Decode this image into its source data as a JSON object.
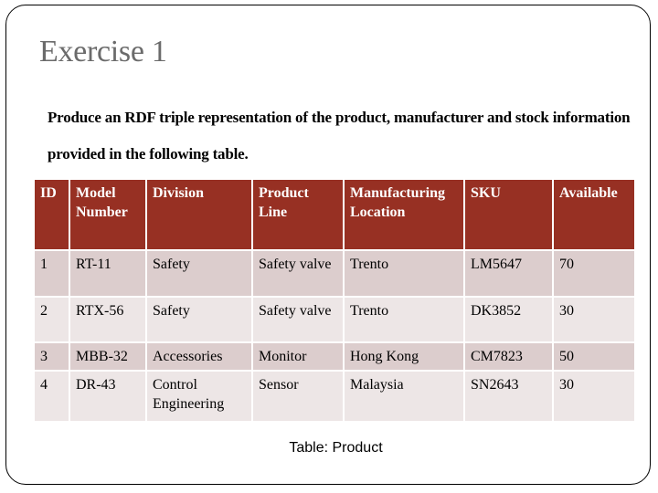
{
  "slide": {
    "title": "Exercise 1",
    "instructions": "Produce an RDF triple representation of the product, manufacturer and stock information provided in the following table.",
    "caption": "Table: Product"
  },
  "colors": {
    "header_bg": "#973023",
    "row_odd_bg": "#dccdcd",
    "row_even_bg": "#ede6e6",
    "title_color": "#6b6b6b"
  },
  "table": {
    "columns": [
      "ID",
      "Model Number",
      "Division",
      "Product Line",
      "Manufacturing Location",
      "SKU",
      "Available"
    ],
    "rows": [
      [
        "1",
        "RT-11",
        "Safety",
        "Safety valve",
        "Trento",
        "LM5647",
        "70"
      ],
      [
        "2",
        "RTX-56",
        "Safety",
        "Safety valve",
        "Trento",
        "DK3852",
        "30"
      ],
      [
        "3",
        "MBB-32",
        "Accessories",
        "Monitor",
        "Hong Kong",
        "CM7823",
        "50"
      ],
      [
        "4",
        "DR-43",
        "Control Engineering",
        "Sensor",
        "Malaysia",
        "SN2643",
        "30"
      ]
    ]
  }
}
